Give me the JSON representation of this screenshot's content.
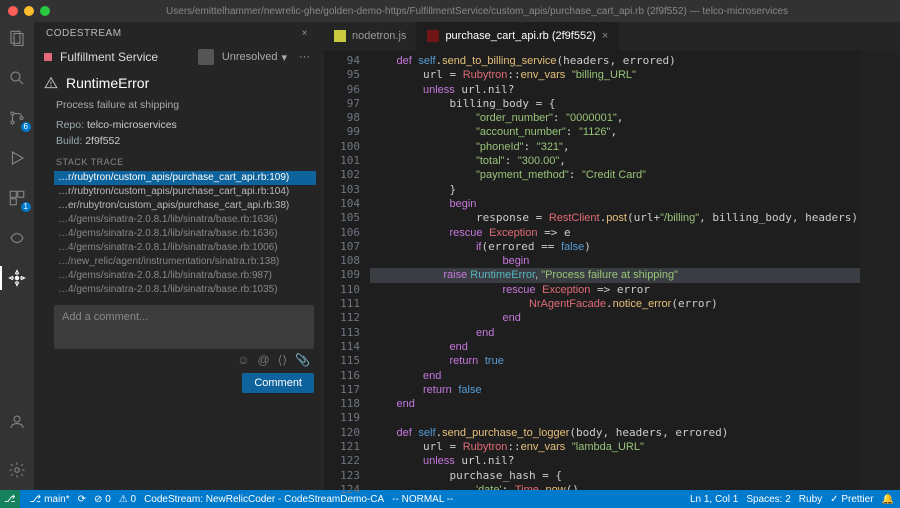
{
  "titlebar": {
    "path": "Users/emittelhammer/newrelic-ghe/golden-demo-https/FulfillmentService/custom_apis/purchase_cart_api.rb (2f9f552) — telco-microservices"
  },
  "sidepanel": {
    "title": "CODESTREAM",
    "service": "Fulfillment Service",
    "status": "Unresolved",
    "more": "···",
    "errorName": "RuntimeError",
    "errorDetail": "Process failure at shipping",
    "repoLabel": "Repo:",
    "repo": "telco-microservices",
    "buildLabel": "Build:",
    "build": "2f9f552",
    "stackLabel": "STACK TRACE",
    "stack": [
      "…r/rubytron/custom_apis/purchase_cart_api.rb:109)",
      "…r/rubytron/custom_apis/purchase_cart_api.rb:104)",
      "…er/rubytron/custom_apis/purchase_cart_api.rb:38)",
      "…4/gems/sinatra-2.0.8.1/lib/sinatra/base.rb:1636)",
      "…4/gems/sinatra-2.0.8.1/lib/sinatra/base.rb:1636)",
      "…4/gems/sinatra-2.0.8.1/lib/sinatra/base.rb:1006)",
      "…/new_relic/agent/instrumentation/sinatra.rb:138)",
      "…4/gems/sinatra-2.0.8.1/lib/sinatra/base.rb:987)",
      "…4/gems/sinatra-2.0.8.1/lib/sinatra/base.rb:1035)"
    ],
    "commentPlaceholder": "Add a comment...",
    "commentBtn": "Comment"
  },
  "tabs": [
    {
      "icon": "js",
      "label": "nodetron.js",
      "active": false
    },
    {
      "icon": "rb",
      "label": "purchase_cart_api.rb (2f9f552)",
      "active": true
    }
  ],
  "code": {
    "startLine": 94,
    "hlLine": 109,
    "lines": [
      "    <span class='k'>def</span> <span class='d'>self</span>.<span class='f'>send_to_billing_service</span>(headers, errored)",
      "        url = <span class='c'>Rubytron</span>::<span class='f'>env_vars</span> <span class='s'>\"billing_URL\"</span>",
      "        <span class='k'>unless</span> url.nil?",
      "            billing_body = {",
      "                <span class='s'>\"order_number\"</span>: <span class='s'>\"0000001\"</span>,",
      "                <span class='s'>\"account_number\"</span>: <span class='s'>\"1126\"</span>,",
      "                <span class='s'>\"phoneId\"</span>: <span class='s'>\"321\"</span>,",
      "                <span class='s'>\"total\"</span>: <span class='s'>\"300.00\"</span>,",
      "                <span class='s'>\"payment_method\"</span>: <span class='s'>\"Credit Card\"</span>",
      "            }",
      "            <span class='k'>begin</span>",
      "                response = <span class='c'>RestClient</span>.<span class='f'>post</span>(url+<span class='s'>\"/billing\"</span>, billing_body, headers)",
      "            <span class='k'>rescue</span> <span class='c'>Exception</span> =&gt; e",
      "                <span class='k'>if</span>(errored == <span class='b'>false</span>)",
      "                    <span class='k'>begin</span>",
      "                        <span class='k'>raise</span> <span class='m'>RuntimeError</span>, <span class='s'>\"Process failure at shipping\"</span>",
      "                    <span class='k'>rescue</span> <span class='c'>Exception</span> =&gt; error",
      "                        <span class='c'>NrAgentFacade</span>.<span class='f'>notice_error</span>(error)",
      "                    <span class='k'>end</span>",
      "                <span class='k'>end</span>",
      "            <span class='k'>end</span>",
      "            <span class='k'>return</span> <span class='b'>true</span>",
      "        <span class='k'>end</span>",
      "        <span class='k'>return</span> <span class='b'>false</span>",
      "    <span class='k'>end</span>",
      "",
      "    <span class='k'>def</span> <span class='d'>self</span>.<span class='f'>send_purchase_to_logger</span>(body, headers, errored)",
      "        url = <span class='c'>Rubytron</span>::<span class='f'>env_vars</span> <span class='s'>\"lambda_URL\"</span>",
      "        <span class='k'>unless</span> url.nil?",
      "            purchase_hash = {",
      "                <span class='s'>'date'</span>: <span class='c'>Time</span>.<span class='f'>now</span>(),"
    ]
  },
  "statusbar": {
    "remote": "⎇",
    "branch": "main*",
    "sync": "⟳",
    "errors": "⊘ 0",
    "warnings": "⚠ 0",
    "codestream": "CodeStream: NewRelicCoder - CodeStreamDemo-CA",
    "mode": "-- NORMAL --",
    "pos": "Ln 1, Col 1",
    "spaces": "Spaces: 2",
    "lang": "Ruby",
    "prettier": "✓ Prettier",
    "bell": "🔔"
  }
}
